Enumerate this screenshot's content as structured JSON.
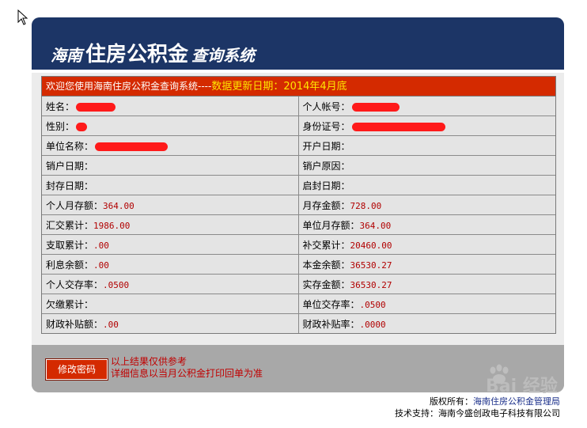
{
  "header": {
    "title_prefix": "海南",
    "title_main": "住房公积金",
    "title_suffix": "查询系统"
  },
  "banner": {
    "welcome": "欢迎您使用海南住房公积金查询系统----",
    "update_date": "数据更新日期：2014年4月底"
  },
  "rows": [
    {
      "l_label": "姓名：",
      "l_value": "",
      "l_redact": 50,
      "r_label": "个人帐号：",
      "r_value": "",
      "r_redact": 60
    },
    {
      "l_label": "性别：",
      "l_value": "",
      "l_redact": 14,
      "r_label": "身份证号：",
      "r_value": "",
      "r_redact": 118
    },
    {
      "l_label": "单位名称：",
      "l_value": "",
      "l_redact": 92,
      "r_label": "开户日期：",
      "r_value": ""
    },
    {
      "l_label": "销户日期：",
      "l_value": "",
      "r_label": "销户原因：",
      "r_value": ""
    },
    {
      "l_label": "封存日期：",
      "l_value": "",
      "r_label": "启封日期：",
      "r_value": ""
    },
    {
      "l_label": "个人月存额：",
      "l_value": "364.00",
      "r_label": "月存金额：",
      "r_value": "728.00"
    },
    {
      "l_label": "汇交累计：",
      "l_value": "1986.00",
      "r_label": "单位月存额：",
      "r_value": "364.00"
    },
    {
      "l_label": "支取累计：",
      "l_value": ".00",
      "r_label": "补交累计：",
      "r_value": "20460.00"
    },
    {
      "l_label": "利息余额：",
      "l_value": ".00",
      "r_label": "本金余额：",
      "r_value": "36530.27"
    },
    {
      "l_label": "个人交存率：",
      "l_value": ".0500",
      "r_label": "实存金额：",
      "r_value": "36530.27"
    },
    {
      "l_label": "欠缴累计：",
      "l_value": "",
      "r_label": "单位交存率：",
      "r_value": ".0500"
    },
    {
      "l_label": "财政补贴额：",
      "l_value": ".00",
      "r_label": "财政补贴率：",
      "r_value": ".0000"
    }
  ],
  "footer": {
    "button_label": "修改密码",
    "note_line1": "以上结果仅供参考",
    "note_line2": "详细信息以当月公积金打印回单为准"
  },
  "credits": {
    "copyright_label": "版权所有：",
    "copyright_owner": "海南住房公积金管理局",
    "support_label": "技术支持：",
    "support_owner": "海南今盛创政电子科技有限公司"
  },
  "watermark": {
    "text": "Bai 经验"
  },
  "colors": {
    "header_bg": "#1c3566",
    "banner_bg": "#d42a00",
    "banner_date": "#ffe600",
    "value_text": "#b10000",
    "redaction": "#ff1a1a"
  }
}
